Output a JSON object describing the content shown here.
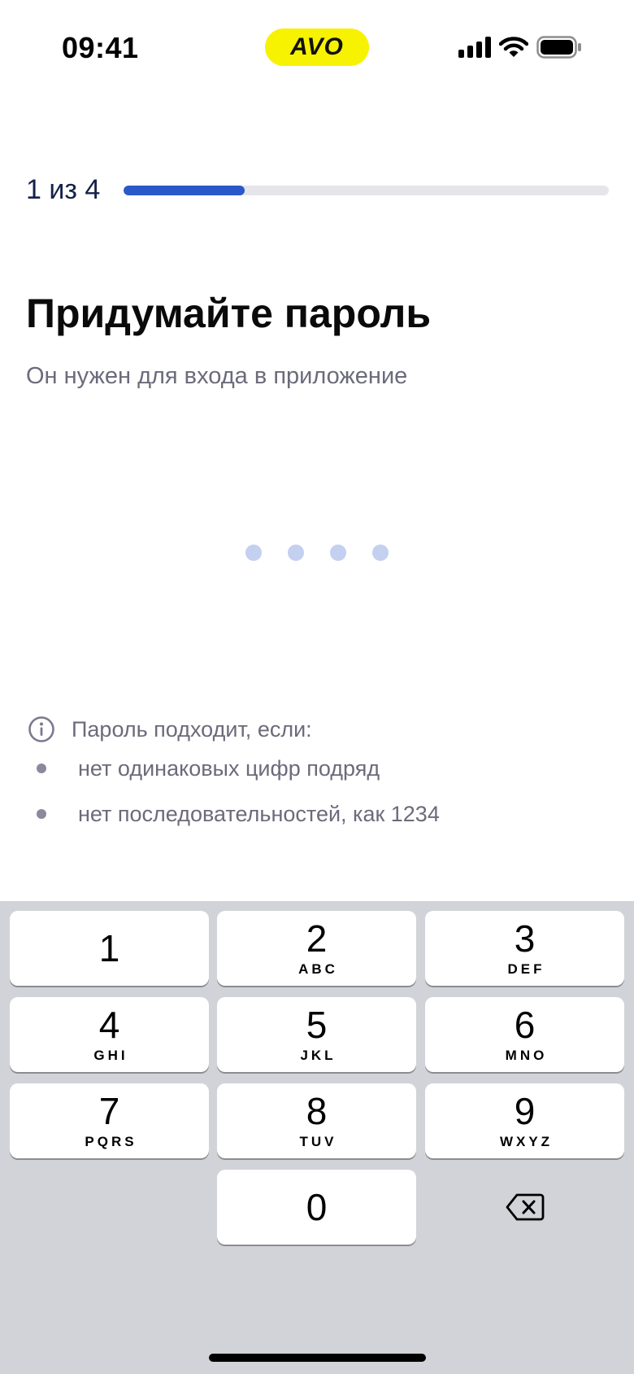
{
  "status_bar": {
    "time": "09:41",
    "brand": "AVO",
    "brand_color": "#f6f200",
    "icons": [
      "signal-icon",
      "wifi-icon",
      "battery-icon"
    ]
  },
  "progress": {
    "step_label": "1 из 4",
    "current_step": 1,
    "total_steps": 4,
    "fill_fraction": 0.25,
    "fill_color": "#2b58c9"
  },
  "title": "Придумайте пароль",
  "subtitle": "Он нужен для входа в приложение",
  "pin": {
    "length": 4,
    "entered": 0
  },
  "rules": {
    "title": "Пароль подходит, если:",
    "items": [
      "нет одинаковых цифр подряд",
      "нет последовательностей, как 1234"
    ]
  },
  "keypad": {
    "keys": [
      {
        "digit": "1",
        "letters": ""
      },
      {
        "digit": "2",
        "letters": "ABC"
      },
      {
        "digit": "3",
        "letters": "DEF"
      },
      {
        "digit": "4",
        "letters": "GHI"
      },
      {
        "digit": "5",
        "letters": "JKL"
      },
      {
        "digit": "6",
        "letters": "MNO"
      },
      {
        "digit": "7",
        "letters": "PQRS"
      },
      {
        "digit": "8",
        "letters": "TUV"
      },
      {
        "digit": "9",
        "letters": "WXYZ"
      },
      {
        "digit": "0",
        "letters": ""
      }
    ],
    "backspace_icon": "backspace-icon"
  }
}
